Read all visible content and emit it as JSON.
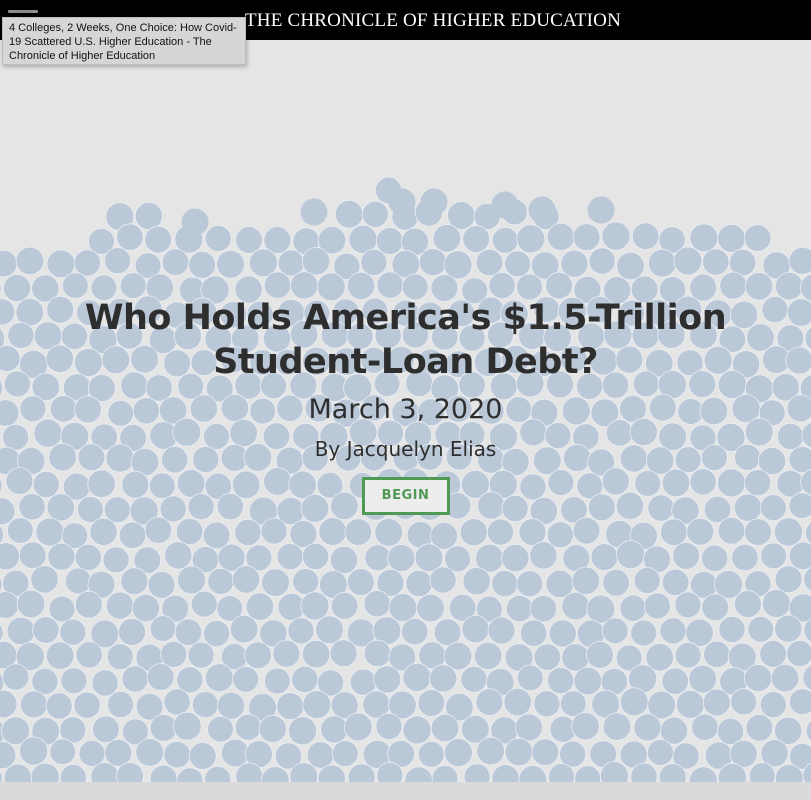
{
  "header": {
    "masthead": "THE CHRONICLE OF HIGHER EDUCATION",
    "menu_icon": "hamburger-menu-icon"
  },
  "tooltip": {
    "text": "4 Colleges, 2 Weeks, One Choice: How Covid-19 Scattered U.S. Higher Education - The Chronicle of Higher Education"
  },
  "hero": {
    "headline": "Who Holds America's $1.5-Trillion Student-Loan Debt?",
    "date": "March 3, 2020",
    "byline": "By Jacquelyn Elias",
    "begin_label": "BEGIN"
  },
  "colors": {
    "background": "#e5e5e5",
    "bubble": "#bac8d8",
    "button_accent": "#4e9a55",
    "header_bg": "#000000"
  }
}
